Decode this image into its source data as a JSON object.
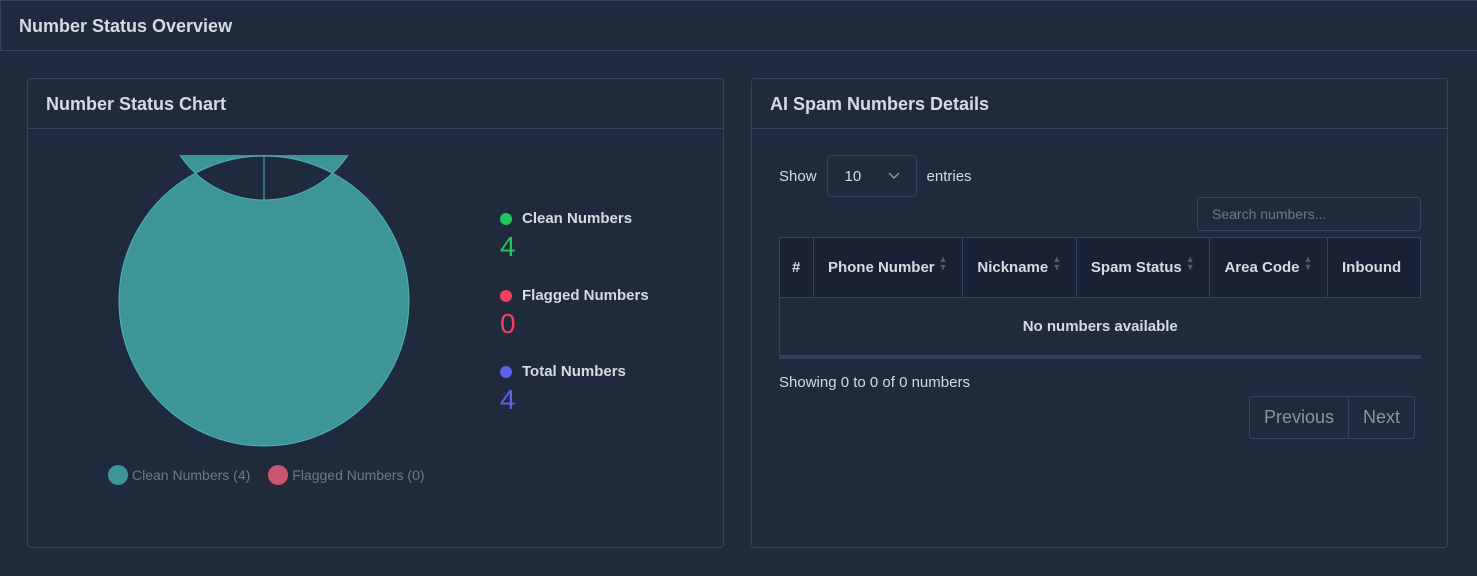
{
  "header": {
    "title": "Number Status Overview"
  },
  "chart_card": {
    "title": "Number Status Chart",
    "legend": [
      {
        "label": "Clean Numbers (4)",
        "color": "#3e9595"
      },
      {
        "label": "Flagged Numbers (0)",
        "color": "#c9566e"
      }
    ]
  },
  "chart_data": {
    "type": "pie",
    "variant": "doughnut",
    "categories": [
      "Clean Numbers",
      "Flagged Numbers"
    ],
    "values": [
      4,
      0
    ],
    "colors": [
      "#3e9595",
      "#c9566e"
    ],
    "legend_position": "bottom"
  },
  "stats": [
    {
      "label": "Clean Numbers",
      "value": "4",
      "color": "#22c55e"
    },
    {
      "label": "Flagged Numbers",
      "value": "0",
      "color": "#f43f5e"
    },
    {
      "label": "Total Numbers",
      "value": "4",
      "color": "#5b63e8"
    }
  ],
  "details_card": {
    "title": "AI Spam Numbers Details",
    "show_label": "Show",
    "entries_value": "10",
    "entries_label": "entries",
    "search_placeholder": "Search numbers...",
    "columns": [
      "#",
      "Phone Number",
      "Nickname",
      "Spam Status",
      "Area Code",
      "Inbound"
    ],
    "empty_message": "No numbers available",
    "info": "Showing 0 to 0 of 0 numbers",
    "prev_label": "Previous",
    "next_label": "Next"
  }
}
